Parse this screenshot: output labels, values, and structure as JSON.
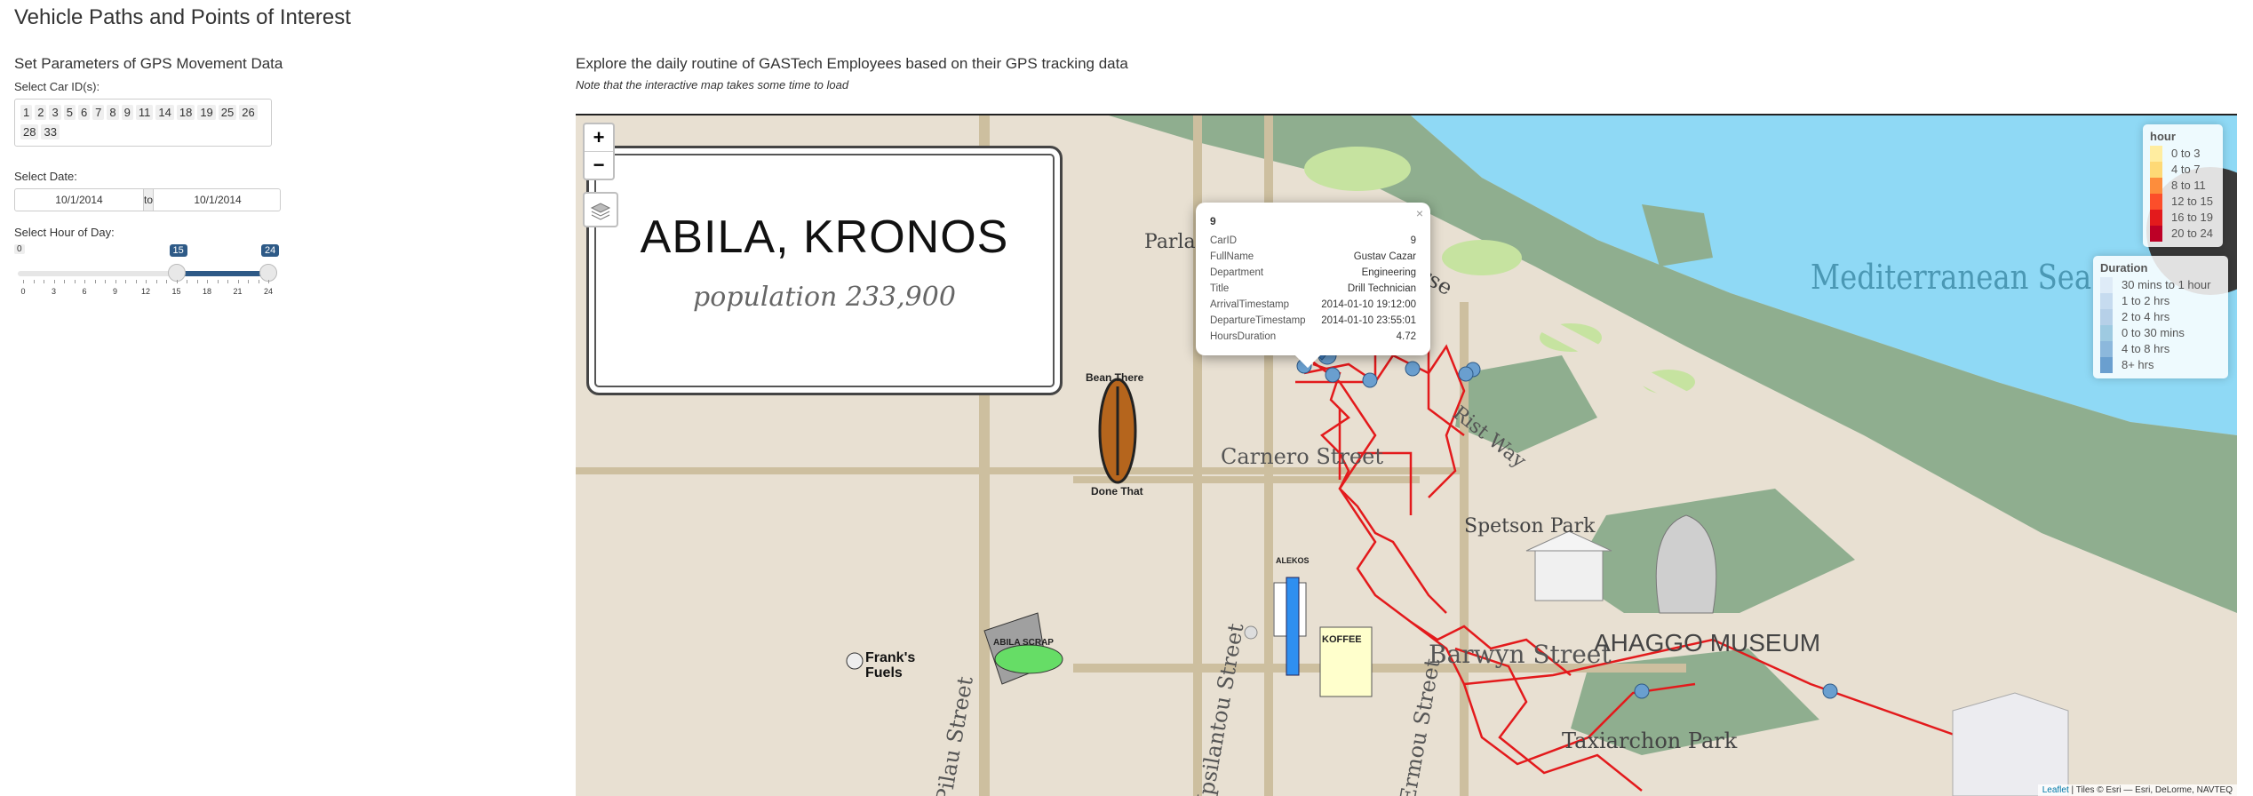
{
  "title": "Vehicle Paths and Points of Interest",
  "left": {
    "heading": "Set Parameters of GPS Movement Data",
    "car_label": "Select Car ID(s):",
    "car_ids": [
      "1",
      "2",
      "3",
      "5",
      "6",
      "7",
      "8",
      "9",
      "11",
      "14",
      "18",
      "19",
      "25",
      "26",
      "28",
      "33"
    ],
    "date_label": "Select Date:",
    "date_start": "10/1/2014",
    "date_to": "to",
    "date_end": "10/1/2014",
    "hour_label": "Select Hour of Day:",
    "hour_min": "0",
    "hour_from": "15",
    "hour_to": "24",
    "hour_range": [
      0,
      24
    ],
    "hour_selected": [
      15,
      24
    ],
    "tick_labels": [
      "0",
      "3",
      "6",
      "9",
      "12",
      "15",
      "18",
      "21",
      "24"
    ]
  },
  "right": {
    "heading": "Explore the daily routine of GASTech Employees based on their GPS tracking data",
    "note": "Note that the interactive map takes some time to load"
  },
  "map": {
    "zoom_in": "+",
    "zoom_out": "−",
    "banner_title": "ABILA, KRONOS",
    "banner_sub": "population 233,900",
    "sea_label": "Mediterranean Sea",
    "street_labels": {
      "carnero": "Carnero Street",
      "barwyn": "Barwyn Street",
      "rist": "Rist Way",
      "spetson": "Spetson Park",
      "taxiarchon": "Taxiarchon Park",
      "ahaggo": "AHAGGO MUSEUM",
      "course": "Golf Course",
      "pilau": "Pilau Street",
      "parla": "Parla",
      "ipsilantou": "Ipsilantou Street",
      "ermou": "Ermou Street",
      "beanthere1": "Bean There",
      "beanthere2": "Done That",
      "franks1": "Frank's",
      "franks2": "Fuels",
      "scrap": "ABILA SCRAP",
      "ouzeri": "KOFFEE",
      "kalami": "ALEKOS"
    },
    "popup": {
      "title": "9",
      "close": "×",
      "rows": [
        {
          "k": "CarID",
          "v": "9"
        },
        {
          "k": "FullName",
          "v": "Gustav Cazar"
        },
        {
          "k": "Department",
          "v": "Engineering"
        },
        {
          "k": "Title",
          "v": "Drill Technician"
        },
        {
          "k": "ArrivalTimestamp",
          "v": "2014-01-10 19:12:00"
        },
        {
          "k": "DepartureTimestamp",
          "v": "2014-01-10 23:55:01"
        },
        {
          "k": "HoursDuration",
          "v": "4.72"
        }
      ]
    },
    "legend_hour": {
      "title": "hour",
      "items": [
        {
          "label": "0 to 3",
          "color": "#ffeda0"
        },
        {
          "label": "4 to 7",
          "color": "#fed976"
        },
        {
          "label": "8 to 11",
          "color": "#fd8d3c"
        },
        {
          "label": "12 to 15",
          "color": "#fc4e2a"
        },
        {
          "label": "16 to 19",
          "color": "#e31a1c"
        },
        {
          "label": "20 to 24",
          "color": "#bd0026"
        }
      ]
    },
    "legend_duration": {
      "title": "Duration",
      "items": [
        {
          "label": "30 mins to 1 hour",
          "color": "#deebf7"
        },
        {
          "label": "1 to 2 hrs",
          "color": "#c6dbef"
        },
        {
          "label": "2 to 4 hrs",
          "color": "#b6d0e8"
        },
        {
          "label": "0 to 30 mins",
          "color": "#9ecae1"
        },
        {
          "label": "4 to 8 hrs",
          "color": "#8cb8dc"
        },
        {
          "label": "8+ hrs",
          "color": "#6a9fcf"
        }
      ]
    },
    "attribution_link": "Leaflet",
    "attribution_text": " | Tiles © Esri — Esri, DeLorme, NAVTEQ"
  }
}
